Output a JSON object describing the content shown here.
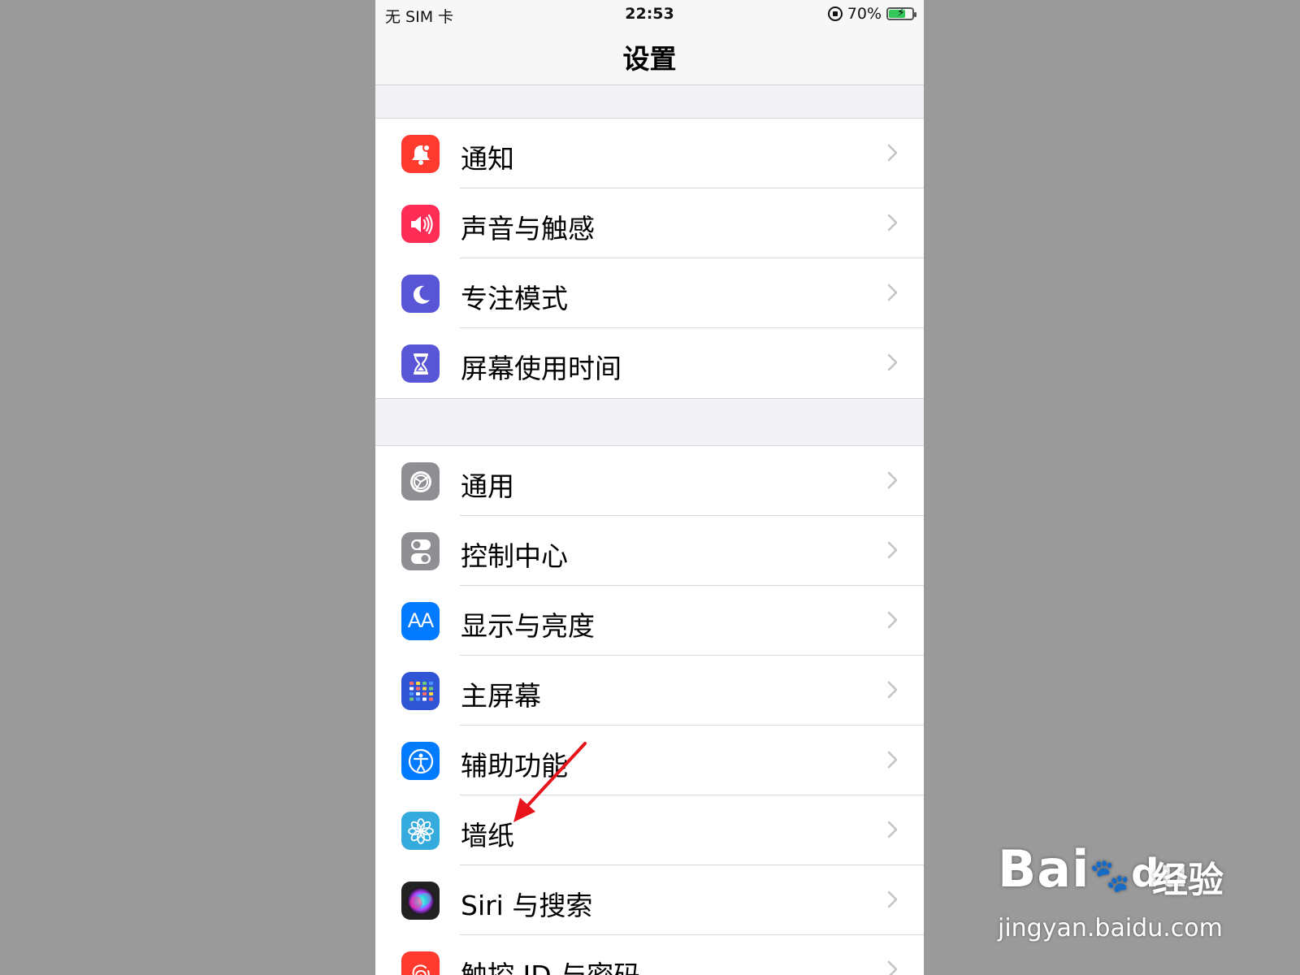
{
  "status_bar": {
    "carrier": "无 SIM 卡",
    "time": "22:53",
    "battery_text": "70%",
    "battery_level": 0.7
  },
  "nav": {
    "title": "设置"
  },
  "groups": [
    {
      "items": [
        {
          "label": "通知",
          "icon": "bell-icon",
          "color": "#ff3b30"
        },
        {
          "label": "声音与触感",
          "icon": "speaker-icon",
          "color": "#ff2d55"
        },
        {
          "label": "专注模式",
          "icon": "moon-icon",
          "color": "#5856d6"
        },
        {
          "label": "屏幕使用时间",
          "icon": "hourglass-icon",
          "color": "#5856d6"
        }
      ]
    },
    {
      "items": [
        {
          "label": "通用",
          "icon": "gear-icon",
          "color": "#8e8e93"
        },
        {
          "label": "控制中心",
          "icon": "toggles-icon",
          "color": "#8e8e93"
        },
        {
          "label": "显示与亮度",
          "icon": "text-size-icon",
          "color": "#007aff"
        },
        {
          "label": "主屏幕",
          "icon": "home-grid-icon",
          "color": "#2f55d4"
        },
        {
          "label": "辅助功能",
          "icon": "accessibility-icon",
          "color": "#007aff"
        },
        {
          "label": "墙纸",
          "icon": "flower-icon",
          "color": "#35aadc"
        },
        {
          "label": "Siri 与搜索",
          "icon": "siri-icon",
          "color": "#222222"
        },
        {
          "label": "触控 ID 与密码",
          "icon": "fingerprint-icon",
          "color": "#ff3b30"
        }
      ]
    }
  ],
  "icon_glyphs": {
    "text_size": "AA"
  },
  "watermark": {
    "brand": "Bai",
    "brand_paw": "du",
    "cn": "经验",
    "url": "jingyan.baidu.com"
  }
}
